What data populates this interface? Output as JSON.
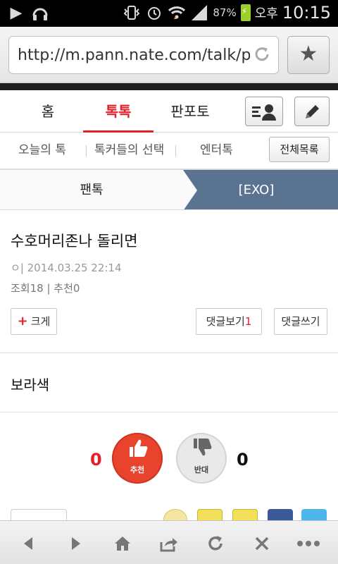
{
  "statusbar": {
    "battery_pct": "87%",
    "ampm": "오후",
    "time": "10:15"
  },
  "browser": {
    "url": "http://m.pann.nate.com/talk/p"
  },
  "mainnav": {
    "tabs": [
      {
        "label": "홈"
      },
      {
        "label": "톡톡"
      },
      {
        "label": "판포토"
      }
    ]
  },
  "subnav": {
    "items": [
      {
        "label": "오늘의 톡"
      },
      {
        "label": "톡커들의 선택"
      },
      {
        "label": "엔터톡"
      }
    ],
    "all_button": "전체목록"
  },
  "breadcrumb": {
    "left": "팬톡",
    "right": "[EXO]"
  },
  "post": {
    "title": "수호머리존나 돌리면",
    "author": "ㅇ",
    "datetime": "2014.03.25 22:14",
    "views_label": "조회18",
    "recommend_label": "추천0",
    "bigger_label": "크게",
    "view_comments_label": "댓글보기",
    "comment_count": "1",
    "write_comment_label": "댓글쓰기",
    "body": "보라색"
  },
  "votes": {
    "up_count": "0",
    "up_label": "추천",
    "down_count": "0",
    "down_label": "반대"
  },
  "colors": {
    "accent": "#e6202b",
    "breadcrumb_active": "#5a7390"
  }
}
